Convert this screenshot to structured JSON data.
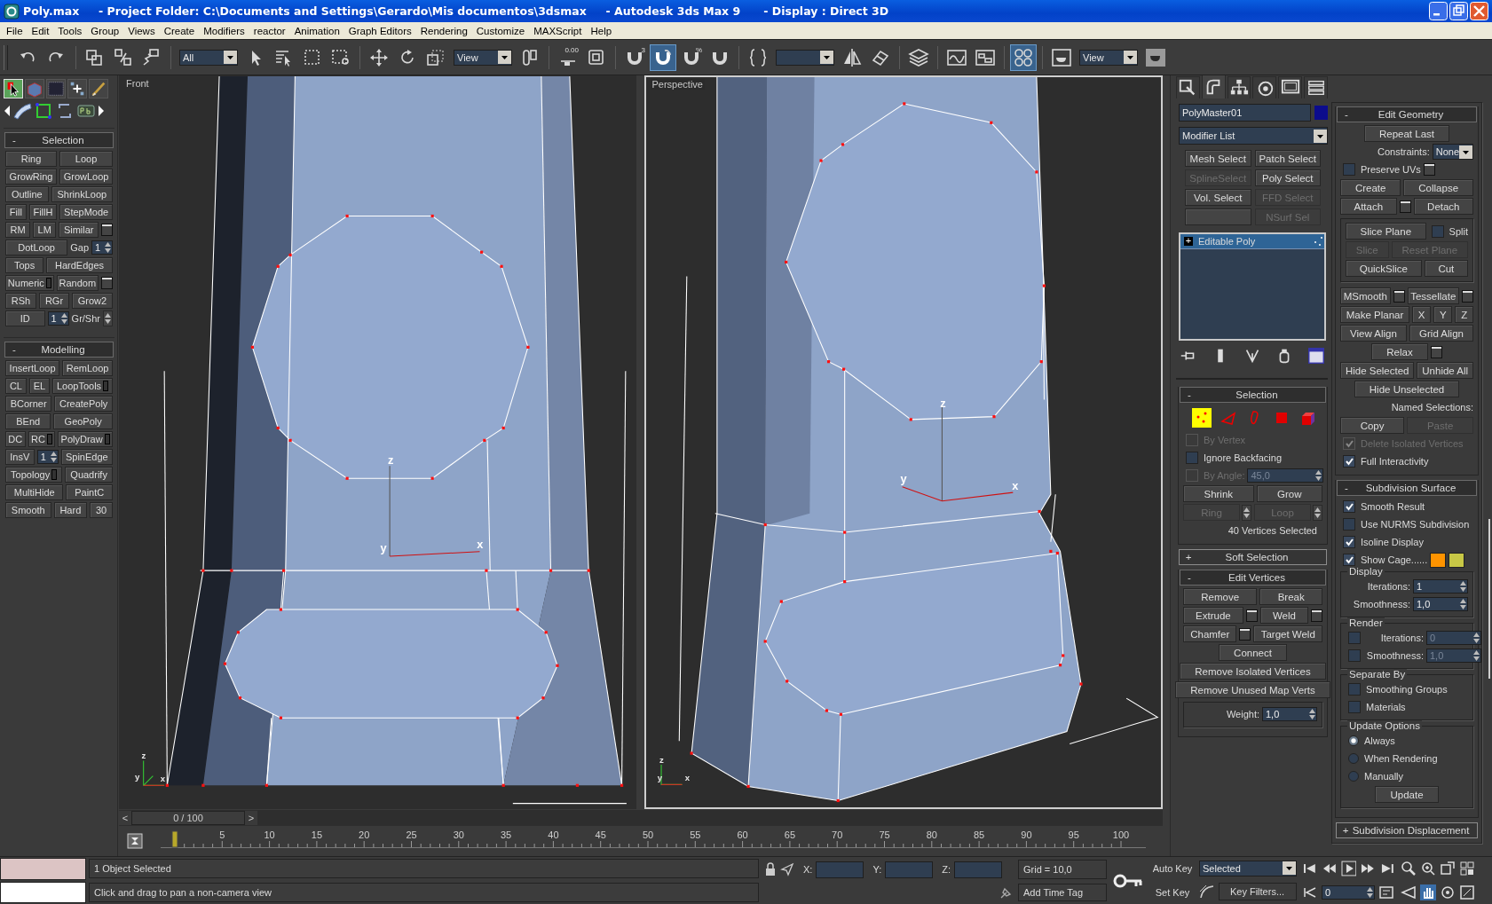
{
  "window": {
    "title": "Poly.max     - Project Folder: C:\\Documents and Settings\\Gerardo\\Mis documentos\\3dsmax     - Autodesk 3ds Max 9      - Display : Direct 3D"
  },
  "menu": [
    "File",
    "Edit",
    "Tools",
    "Group",
    "Views",
    "Create",
    "Modifiers",
    "reactor",
    "Animation",
    "Graph Editors",
    "Rendering",
    "Customize",
    "MAXScript",
    "Help"
  ],
  "toolbar": [
    {
      "kind": "tool",
      "selected": false
    },
    {
      "kind": "tool",
      "selected": false
    },
    {
      "kind": "separator"
    },
    {
      "kind": "tool",
      "selected": false
    },
    {
      "kind": "tool",
      "selected": false
    },
    {
      "kind": "tool",
      "selected": false
    },
    {
      "kind": "separator"
    },
    {
      "kind": "dropdown",
      "value": "All"
    },
    {
      "kind": "tool",
      "selected": false
    },
    {
      "kind": "tool",
      "selected": false
    },
    {
      "kind": "tool",
      "selected": false
    },
    {
      "kind": "tool",
      "selected": false
    },
    {
      "kind": "separator"
    },
    {
      "kind": "tool",
      "selected": false
    },
    {
      "kind": "tool",
      "selected": false
    },
    {
      "kind": "tool",
      "selected": false
    },
    {
      "kind": "dropdown",
      "value": "View"
    },
    {
      "kind": "tool",
      "selected": false
    },
    {
      "kind": "separator"
    },
    {
      "kind": "tool",
      "selected": false,
      "text": "0.00"
    },
    {
      "kind": "tool",
      "selected": false
    },
    {
      "kind": "separator"
    },
    {
      "kind": "tool",
      "selected": false,
      "text": "3"
    },
    {
      "kind": "tool",
      "selected": true
    },
    {
      "kind": "tool",
      "selected": false,
      "text": "%"
    },
    {
      "kind": "tool",
      "selected": false
    },
    {
      "kind": "separator"
    },
    {
      "kind": "tool",
      "selected": false
    },
    {
      "kind": "dropdown"
    },
    {
      "kind": "tool",
      "selected": false
    },
    {
      "kind": "tool",
      "selected": false
    },
    {
      "kind": "separator"
    },
    {
      "kind": "tool",
      "selected": false
    },
    {
      "kind": "separator"
    },
    {
      "kind": "tool",
      "selected": false
    },
    {
      "kind": "tool",
      "selected": false
    },
    {
      "kind": "separator"
    },
    {
      "kind": "tool",
      "selected": true
    },
    {
      "kind": "separator"
    },
    {
      "kind": "tool",
      "selected": false
    },
    {
      "kind": "dropdown",
      "value": "View"
    },
    {
      "kind": "tool",
      "selected": false
    }
  ],
  "left_panel": {
    "tabs": [
      {
        "selected": true
      },
      {
        "selected": false
      },
      {
        "selected": false
      },
      {
        "selected": false
      },
      {
        "selected": false
      }
    ],
    "rollouts": [
      {
        "title": "Selection",
        "toggle": "-",
        "expanded": true,
        "rows": [
          [
            {
              "kind": "button",
              "label": "Ring"
            },
            {
              "kind": "button",
              "label": "Loop"
            }
          ],
          [
            {
              "kind": "button",
              "label": "GrowRing"
            },
            {
              "kind": "button",
              "label": "GrowLoop"
            }
          ],
          [
            {
              "kind": "button",
              "label": "Outline"
            },
            {
              "kind": "button",
              "label": "ShrinkLoop"
            }
          ],
          [
            {
              "kind": "button",
              "label": "Fill"
            },
            {
              "kind": "button",
              "label": "FillH"
            },
            {
              "kind": "button",
              "label": "StepMode"
            }
          ],
          [
            {
              "kind": "button",
              "label": "RM"
            },
            {
              "kind": "button",
              "label": "LM"
            },
            {
              "kind": "button",
              "label": "Similar"
            },
            {
              "kind": "opt"
            }
          ],
          [
            {
              "kind": "button",
              "label": "DotLoop"
            },
            {
              "kind": "label",
              "text": "Gap"
            },
            {
              "kind": "spinner",
              "value": "1"
            }
          ],
          [
            {
              "kind": "button",
              "label": "Tops"
            },
            {
              "kind": "button",
              "label": "HardEdges"
            }
          ],
          [
            {
              "kind": "mbutton",
              "label": "Numeric"
            },
            {
              "kind": "button",
              "label": "Random"
            },
            {
              "kind": "opt"
            }
          ],
          [
            {
              "kind": "button",
              "label": "RSh"
            },
            {
              "kind": "button",
              "label": "RGr"
            },
            {
              "kind": "button",
              "label": "Grow2"
            }
          ],
          [
            {
              "kind": "button",
              "label": "ID"
            },
            {
              "kind": "spinner",
              "value": "1"
            },
            {
              "kind": "label",
              "text": "Gr/Shr"
            },
            {
              "kind": "arrows"
            }
          ]
        ]
      },
      {
        "title": "Modelling",
        "toggle": "-",
        "expanded": true,
        "rows": [
          [
            {
              "kind": "button",
              "label": "InsertLoop"
            },
            {
              "kind": "button",
              "label": "RemLoop"
            }
          ],
          [
            {
              "kind": "button",
              "label": "CL"
            },
            {
              "kind": "button",
              "label": "EL"
            },
            {
              "kind": "mbutton",
              "label": "LoopTools"
            }
          ],
          [
            {
              "kind": "button",
              "label": "BCorner"
            },
            {
              "kind": "button",
              "label": "CreatePoly"
            }
          ],
          [
            {
              "kind": "button",
              "label": "BEnd"
            },
            {
              "kind": "button",
              "label": "GeoPoly"
            }
          ],
          [
            {
              "kind": "button",
              "label": "DC"
            },
            {
              "kind": "mbutton",
              "label": "RC"
            },
            {
              "kind": "mbutton",
              "label": "PolyDraw"
            }
          ],
          [
            {
              "kind": "button",
              "label": "InsV"
            },
            {
              "kind": "spinner",
              "value": "1"
            },
            {
              "kind": "button",
              "label": "SpinEdge"
            }
          ],
          [
            {
              "kind": "mbutton",
              "label": "Topology"
            },
            {
              "kind": "button",
              "label": "Quadrify"
            }
          ],
          [
            {
              "kind": "button",
              "label": "MultiHide"
            },
            {
              "kind": "button",
              "label": "PaintC"
            }
          ],
          [
            {
              "kind": "button",
              "label": "Smooth"
            },
            {
              "kind": "button",
              "label": "Hard"
            },
            {
              "kind": "button",
              "label": "30"
            }
          ]
        ]
      }
    ]
  },
  "viewports": [
    {
      "label": "Front",
      "active": false,
      "gizmo_labels": [
        "z",
        "y",
        "x"
      ],
      "tripod_labels": [
        "z",
        "y",
        "x"
      ]
    },
    {
      "label": "Perspective",
      "active": true,
      "gizmo_labels": [
        "z",
        "y",
        "x"
      ],
      "tripod_labels": [
        "z",
        "y",
        "x"
      ]
    }
  ],
  "time_slider": {
    "prev": "<",
    "label": "0 / 100",
    "next": ">",
    "level": 0
  },
  "trackbar": {
    "labels": [
      "5",
      "10",
      "15",
      "20",
      "25",
      "30",
      "35",
      "40",
      "45",
      "50",
      "55",
      "60",
      "65",
      "70",
      "75",
      "80",
      "85",
      "90",
      "95",
      "100"
    ]
  },
  "command_panel": {
    "tabs": [
      {
        "selected": false
      },
      {
        "selected": true
      },
      {
        "selected": false
      },
      {
        "selected": false
      },
      {
        "selected": false
      },
      {
        "selected": false
      }
    ],
    "object": {
      "name": "PolyMaster01",
      "color": "#0c0c8c"
    },
    "modifier_list": "Modifier List",
    "modifier_buttons": [
      {
        "label": "Mesh Select",
        "disabled": false
      },
      {
        "label": "Patch Select",
        "disabled": false
      },
      {
        "label": "SplineSelect",
        "disabled": true
      },
      {
        "label": "Poly Select",
        "disabled": false
      },
      {
        "label": "Vol. Select",
        "disabled": false
      },
      {
        "label": "FFD Select",
        "disabled": true
      },
      {
        "disabled": false
      },
      {
        "label": "NSurf Sel",
        "disabled": true
      }
    ],
    "stack": [
      {
        "toggle": "+",
        "label": "Editable Poly",
        "selected": true
      }
    ],
    "left_rollouts": [
      {
        "title": "Selection",
        "toggle": "-",
        "expanded": true,
        "rows": [
          [
            {
              "kind": "subobjects",
              "items": [
                {
                  "selected": true
                },
                {
                  "selected": false
                },
                {
                  "selected": false
                },
                {
                  "selected": false
                },
                {
                  "selected": false
                }
              ]
            }
          ],
          [
            {
              "kind": "check",
              "label": "By Vertex",
              "checked": false,
              "disabled": true
            }
          ],
          [
            {
              "kind": "check",
              "label": "Ignore Backfacing",
              "checked": false,
              "disabled": false
            }
          ],
          [
            {
              "kind": "check",
              "label": "By Angle:",
              "checked": false,
              "disabled": true
            },
            {
              "kind": "spinner",
              "value": "45,0",
              "disabled": true
            }
          ],
          [
            {
              "kind": "button",
              "label": "Shrink"
            },
            {
              "kind": "button",
              "label": "Grow"
            }
          ],
          [
            {
              "kind": "button",
              "label": "Ring",
              "disabled": true,
              "arrows": true
            },
            {
              "kind": "button",
              "label": "Loop",
              "disabled": true,
              "arrows": true
            }
          ],
          [
            {
              "kind": "info",
              "text": "40 Vertices Selected"
            }
          ]
        ]
      },
      {
        "title": "Soft Selection",
        "toggle": "+",
        "expanded": false
      },
      {
        "title": "Edit Vertices",
        "toggle": "-",
        "expanded": true,
        "rows": [
          [
            {
              "kind": "button",
              "label": "Remove"
            },
            {
              "kind": "button",
              "label": "Break"
            }
          ],
          [
            {
              "kind": "button",
              "label": "Extrude"
            },
            {
              "kind": "opt"
            },
            {
              "kind": "button",
              "label": "Weld"
            },
            {
              "kind": "opt"
            }
          ],
          [
            {
              "kind": "button",
              "label": "Chamfer"
            },
            {
              "kind": "opt"
            },
            {
              "kind": "button",
              "label": "Target Weld"
            }
          ],
          [
            {
              "kind": "button",
              "label": "Connect"
            }
          ],
          [
            {
              "kind": "button",
              "label": "Remove Isolated Vertices"
            }
          ],
          [
            {
              "kind": "button",
              "label": "Remove Unused Map Verts"
            }
          ],
          {
            "kind": "group",
            "rows": [
              [
                {
                  "kind": "label",
                  "text": "Weight:"
                },
                {
                  "kind": "spinner",
                  "value": "1,0"
                }
              ]
            ]
          }
        ]
      }
    ],
    "right_rollouts": [
      {
        "title": "Edit Geometry",
        "toggle": "-",
        "expanded": true,
        "rows": [
          [
            {
              "kind": "button",
              "label": "Repeat Last"
            }
          ],
          [
            {
              "kind": "label",
              "text": "Constraints:"
            },
            {
              "kind": "dropdown",
              "value": "None"
            }
          ],
          [
            {
              "kind": "check",
              "label": "Preserve UVs",
              "checked": false
            },
            {
              "kind": "opt"
            }
          ],
          [
            {
              "kind": "button",
              "label": "Create"
            },
            {
              "kind": "button",
              "label": "Collapse"
            }
          ],
          [
            {
              "kind": "button",
              "label": "Attach"
            },
            {
              "kind": "opt"
            },
            {
              "kind": "button",
              "label": "Detach"
            }
          ],
          {
            "kind": "group",
            "rows": [
              [
                {
                  "kind": "button",
                  "label": "Slice Plane"
                },
                {
                  "kind": "check",
                  "label": "Split",
                  "checked": false
                }
              ],
              [
                {
                  "kind": "button",
                  "label": "Slice",
                  "disabled": true
                },
                {
                  "kind": "button",
                  "label": "Reset Plane",
                  "disabled": true
                }
              ],
              [
                {
                  "kind": "button",
                  "label": "QuickSlice"
                },
                {
                  "kind": "button",
                  "label": "Cut"
                }
              ]
            ]
          },
          [
            {
              "kind": "button",
              "label": "MSmooth"
            },
            {
              "kind": "opt"
            },
            {
              "kind": "button",
              "label": "Tessellate"
            },
            {
              "kind": "opt"
            }
          ],
          [
            {
              "kind": "button",
              "label": "Make Planar"
            },
            {
              "kind": "button",
              "label": "X"
            },
            {
              "kind": "button",
              "label": "Y"
            },
            {
              "kind": "button",
              "label": "Z"
            }
          ],
          [
            {
              "kind": "button",
              "label": "View Align"
            },
            {
              "kind": "button",
              "label": "Grid Align"
            }
          ],
          [
            {
              "kind": "button",
              "label": "Relax"
            },
            {
              "kind": "opt"
            }
          ],
          [
            {
              "kind": "button",
              "label": "Hide Selected"
            },
            {
              "kind": "button",
              "label": "Unhide All"
            }
          ],
          [
            {
              "kind": "button",
              "label": "Hide Unselected"
            }
          ],
          [
            {
              "kind": "label",
              "text": "Named Selections:"
            }
          ],
          [
            {
              "kind": "button",
              "label": "Copy"
            },
            {
              "kind": "button",
              "label": "Paste",
              "disabled": true
            }
          ],
          [
            {
              "kind": "check",
              "label": "Delete Isolated Vertices",
              "checked": true,
              "disabled": true
            }
          ],
          [
            {
              "kind": "check",
              "label": "Full Interactivity",
              "checked": true,
              "disabled": false
            }
          ]
        ]
      },
      {
        "title": "Subdivision Surface",
        "toggle": "-",
        "expanded": true,
        "rows": [
          [
            {
              "kind": "check",
              "label": "Smooth Result",
              "checked": true
            }
          ],
          [
            {
              "kind": "check",
              "label": "Use NURMS Subdivision",
              "checked": false
            }
          ],
          [
            {
              "kind": "check",
              "label": "Isoline Display",
              "checked": true
            }
          ],
          [
            {
              "kind": "check",
              "label": "Show Cage......",
              "checked": true
            },
            {
              "kind": "swatch",
              "color": "#ff9400"
            },
            {
              "kind": "swatch",
              "color": "#c8c846"
            }
          ],
          {
            "kind": "group",
            "title": "Display",
            "rows": [
              [
                {
                  "kind": "label",
                  "text": "Iterations:"
                },
                {
                  "kind": "spinner",
                  "value": "1"
                }
              ],
              [
                {
                  "kind": "label",
                  "text": "Smoothness:"
                },
                {
                  "kind": "spinner",
                  "value": "1,0"
                }
              ]
            ]
          },
          {
            "kind": "group",
            "title": "Render",
            "rows": [
              [
                {
                  "kind": "check",
                  "checked": false
                },
                {
                  "kind": "label",
                  "text": "Iterations:"
                },
                {
                  "kind": "spinner",
                  "value": "0",
                  "disabled": true
                }
              ],
              [
                {
                  "kind": "check",
                  "checked": false
                },
                {
                  "kind": "label",
                  "text": "Smoothness:"
                },
                {
                  "kind": "spinner",
                  "value": "1,0",
                  "disabled": true
                }
              ]
            ]
          },
          {
            "kind": "group",
            "title": "Separate By",
            "rows": [
              [
                {
                  "kind": "check",
                  "label": "Smoothing Groups",
                  "checked": false
                }
              ],
              [
                {
                  "kind": "check",
                  "label": "Materials",
                  "checked": false
                }
              ]
            ]
          },
          {
            "kind": "group",
            "title": "Update Options",
            "rows": [
              [
                {
                  "kind": "radio",
                  "label": "Always",
                  "selected": true
                }
              ],
              [
                {
                  "kind": "radio",
                  "label": "When Rendering",
                  "selected": false
                }
              ],
              [
                {
                  "kind": "radio",
                  "label": "Manually",
                  "selected": false
                }
              ],
              [
                {
                  "kind": "button",
                  "label": "Update"
                }
              ]
            ]
          }
        ]
      },
      {
        "title": "Subdivision Displacement",
        "toggle": "+",
        "expanded": false
      }
    ]
  },
  "status_bar": {
    "swatches": [
      {
        "color": "#dcc4c4"
      },
      {
        "color": "#ffffff"
      }
    ],
    "selection_info": "1 Object Selected",
    "prompt": "Click and drag to pan a non-camera view",
    "coords": [
      "X:",
      "Y:",
      "Z:"
    ],
    "grid": "Grid = 10,0",
    "time_tag": "Add Time Tag",
    "auto_key": {
      "label": "Auto Key",
      "on": false
    },
    "set_key": "Set Key",
    "key_mode": "Selected",
    "key_filters": "Key Filters...",
    "frame": "0"
  }
}
